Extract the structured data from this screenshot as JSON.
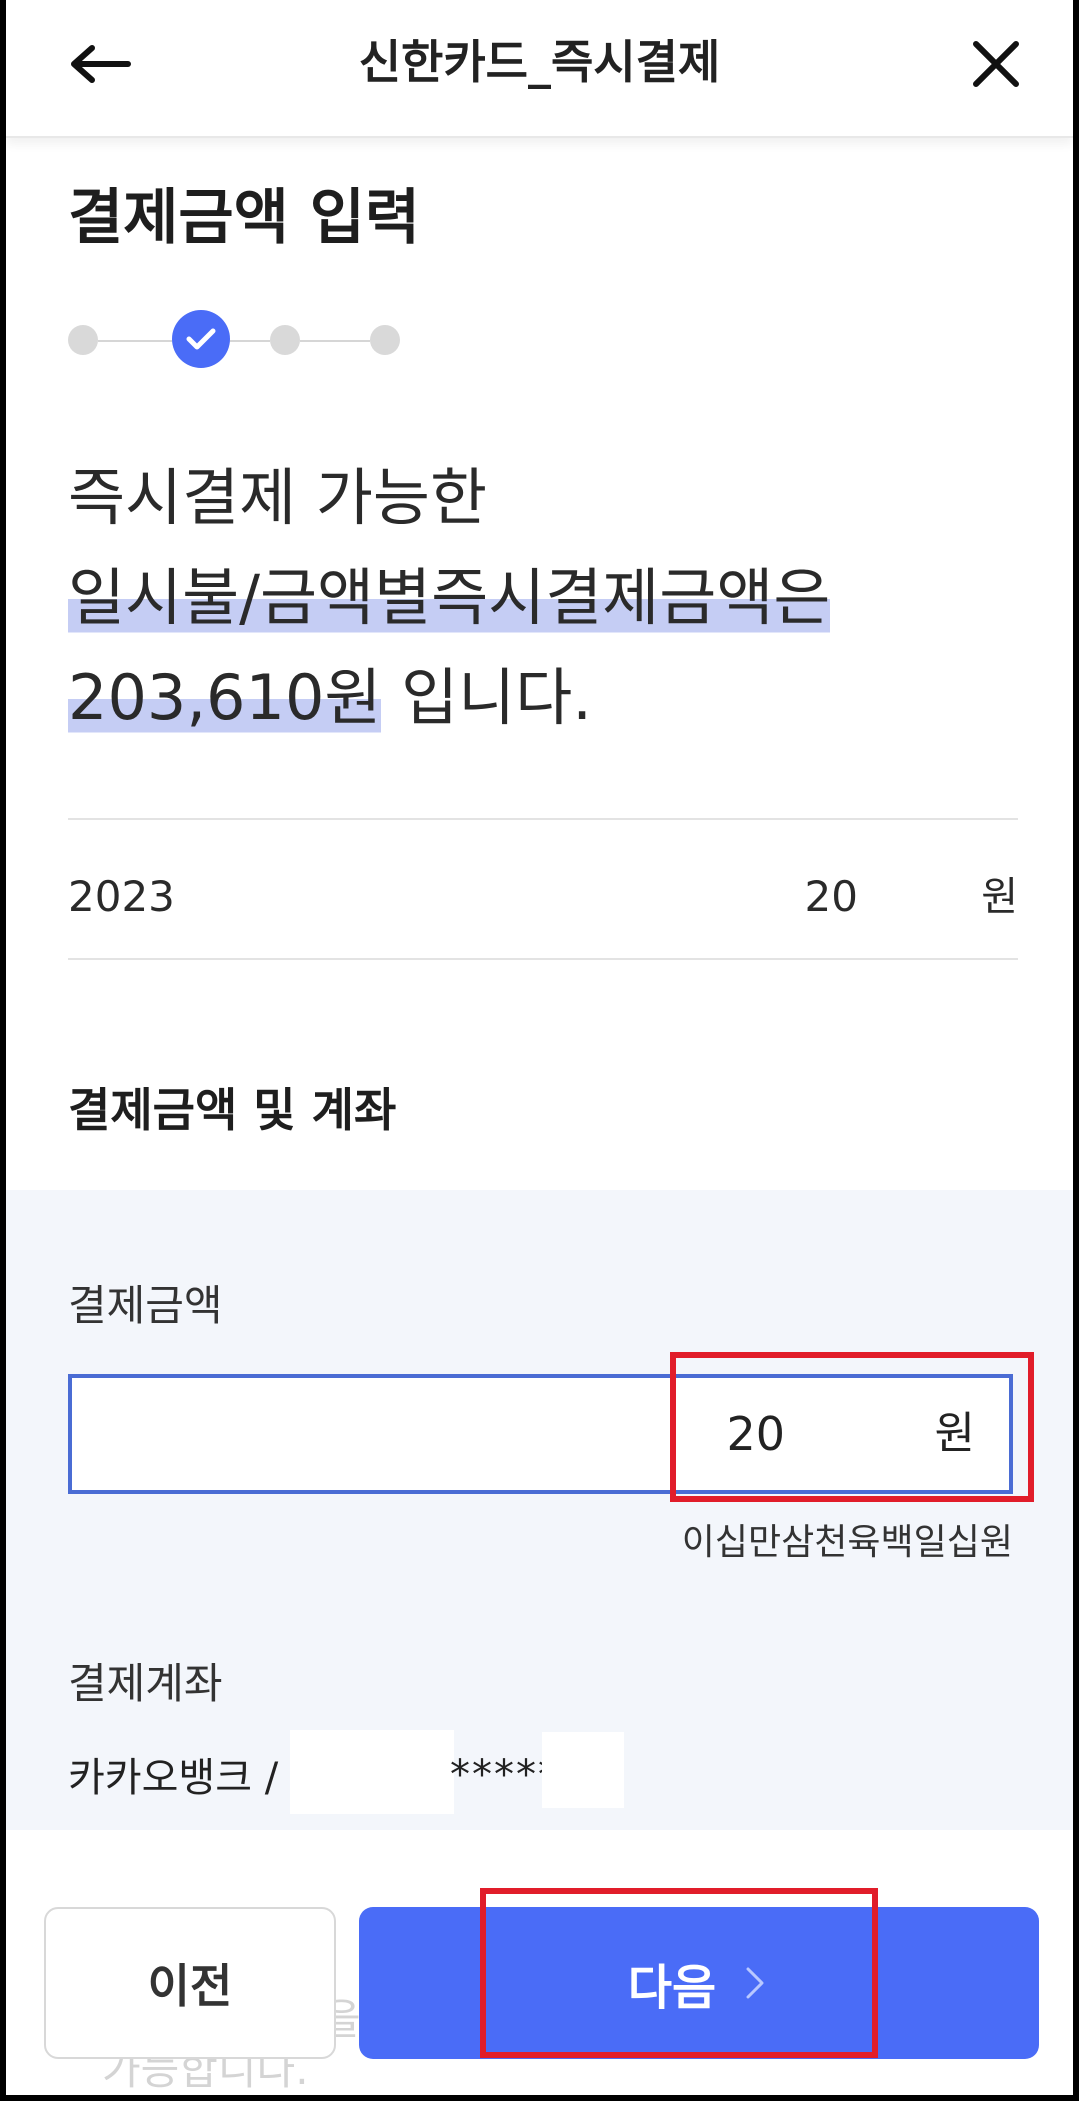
{
  "appbar": {
    "title": "신한카드_즉시결제",
    "back_icon": "arrow-left-icon",
    "close_icon": "close-icon"
  },
  "page": {
    "heading": "결제금액 입력",
    "stepper": {
      "total_steps": 4,
      "current_step": 2
    },
    "headline": {
      "line1": "즉시결제 가능한",
      "line2": "일시불/금액별즉시결제금액은",
      "line3_amount": "203,610원",
      "line3_suffix": " 입니다."
    },
    "summary_row": {
      "left": "2023",
      "amount": "20",
      "unit": "원"
    }
  },
  "payment": {
    "section_title": "결제금액 및 계좌",
    "amount_label": "결제금액",
    "amount_value": "20",
    "amount_unit": "원",
    "amount_in_korean": "이십만삼천육백일십원",
    "account_label": "결제계좌",
    "account_text": "카카오뱅크 /",
    "account_masked": "*****"
  },
  "background_text": {
    "line1": "을",
    "line2": "가능합니다."
  },
  "buttons": {
    "prev": "이전",
    "next": "다음"
  },
  "colors": {
    "primary": "#4a6cf7",
    "highlight": "#c5cdf4",
    "annotation": "#e11d2a",
    "gray_bg": "#f3f6fb"
  }
}
